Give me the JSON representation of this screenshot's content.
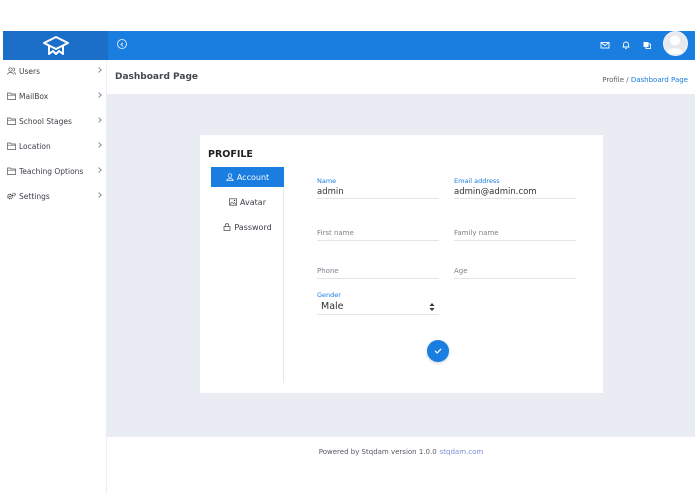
{
  "topbar": {
    "icons": [
      "graduation-cap-logo",
      "menu-toggle-icon",
      "mail-icon",
      "bell-icon",
      "translate-icon",
      "user-avatar"
    ]
  },
  "sidebar": {
    "items": [
      {
        "label": "Users",
        "icon": "users-icon"
      },
      {
        "label": "MailBox",
        "icon": "folder-icon"
      },
      {
        "label": "School Stages",
        "icon": "folder-icon"
      },
      {
        "label": "Location",
        "icon": "folder-icon"
      },
      {
        "label": "Teaching Options",
        "icon": "folder-icon"
      },
      {
        "label": "Settings",
        "icon": "gears-icon"
      }
    ]
  },
  "header": {
    "title": "Dashboard Page",
    "breadcrumb": {
      "first": "Profile",
      "separator": "/",
      "current": "Dashboard Page"
    }
  },
  "profile": {
    "title": "PROFILE",
    "tabs": [
      {
        "label": "Account",
        "icon": "user-icon",
        "active": true
      },
      {
        "label": "Avatar",
        "icon": "image-icon",
        "active": false
      },
      {
        "label": "Password",
        "icon": "lock-icon",
        "active": false
      }
    ],
    "fields": {
      "name": {
        "label": "Name",
        "value": "admin"
      },
      "email": {
        "label": "Email address",
        "value": "admin@admin.com"
      },
      "first_name": {
        "placeholder": "First name"
      },
      "family_name": {
        "placeholder": "Family name"
      },
      "phone": {
        "placeholder": "Phone"
      },
      "age": {
        "placeholder": "Age"
      },
      "gender": {
        "label": "Gender",
        "value": "Male"
      }
    },
    "submit_icon": "check-icon"
  },
  "footer": {
    "text": "Powered by Stqdam version 1.0.0",
    "link": "stqdam.com"
  },
  "colors": {
    "primary": "#1a7de0",
    "logo_bg": "#1b6fc8",
    "content_bg": "#e9edf3"
  }
}
